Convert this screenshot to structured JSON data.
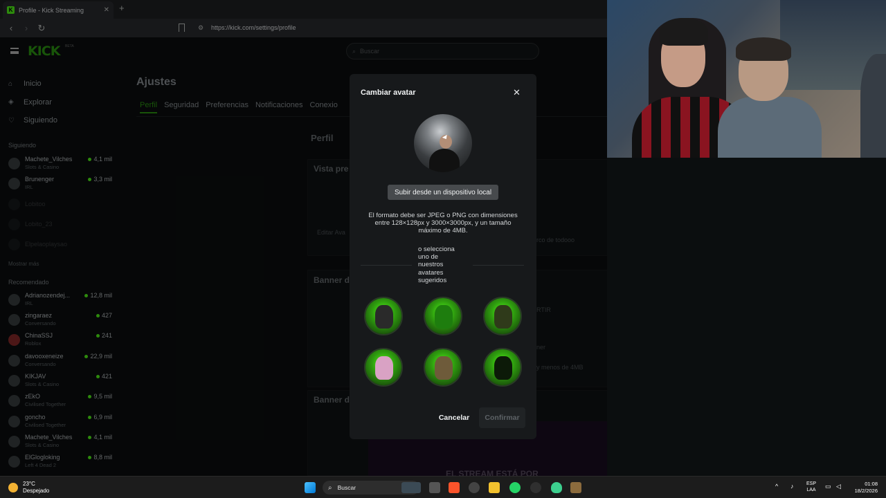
{
  "browser": {
    "tab_title": "Profile - Kick Streaming",
    "tab_close": "✕",
    "new_tab": "+",
    "url": "https://kick.com/settings/profile"
  },
  "kick": {
    "logo": "KICK",
    "beta": "BETA",
    "search_placeholder": "Buscar",
    "nav": [
      {
        "label": "Inicio",
        "icon": "home-icon",
        "glyph": "⌂"
      },
      {
        "label": "Explorar",
        "icon": "compass-icon",
        "glyph": "◈"
      },
      {
        "label": "Siguiendo",
        "icon": "heart-icon",
        "glyph": "♡"
      }
    ],
    "following_header": "Siguiendo",
    "following": [
      {
        "name": "Machete_Vilches",
        "category": "Slots & Casino",
        "viewers": "4,1 mil",
        "live": true
      },
      {
        "name": "Brunenger",
        "category": "IRL",
        "viewers": "3,3 mil",
        "live": true
      },
      {
        "name": "Lobitoo",
        "category": "",
        "viewers": "",
        "live": false
      },
      {
        "name": "Lobito_23",
        "category": "",
        "viewers": "",
        "live": false
      },
      {
        "name": "Elpelaoplaysao",
        "category": "",
        "viewers": "",
        "live": false
      }
    ],
    "show_more": "Mostrar más",
    "recommended_header": "Recomendado",
    "recommended": [
      {
        "name": "Adrianozendej...",
        "category": "IRL",
        "viewers": "12,8 mil"
      },
      {
        "name": "zingaraez",
        "category": "Conversando",
        "viewers": "427"
      },
      {
        "name": "ChinaSSJ",
        "category": "Roblox",
        "viewers": "241"
      },
      {
        "name": "davooxeneize",
        "category": "Conversando",
        "viewers": "22,9 mil"
      },
      {
        "name": "KIKJAV",
        "category": "Slots & Casino",
        "viewers": "421"
      },
      {
        "name": "zEkO",
        "category": "Civilised Together",
        "viewers": "9,5 mil"
      },
      {
        "name": "goncho",
        "category": "Civilised Together",
        "viewers": "6,9 mil"
      },
      {
        "name": "Machete_Vilches",
        "category": "Slots & Casino",
        "viewers": "4,1 mil"
      },
      {
        "name": "ElGlogloking",
        "category": "Left 4 Dead 2",
        "viewers": "8,8 mil"
      }
    ],
    "settings_title": "Ajustes",
    "settings_tabs": [
      "Perfil",
      "Seguridad",
      "Preferencias",
      "Notificaciones",
      "Conexio"
    ],
    "profile_heading": "Perfil",
    "preview_heading": "Vista pre",
    "edit_avatar": "Editar Ava",
    "banner_heading": "Banner d",
    "banner_heading_2": "Banner de",
    "bg_text_1": "rco de todooo",
    "bg_text_2": "y menos de 4MB",
    "bg_text_3": "ner",
    "bg_text_4": "RTIR",
    "bg_stream": "EL STREAM ESTÁ POR"
  },
  "modal": {
    "title": "Cambiar avatar",
    "close": "✕",
    "upload_button": "Subir desde un dispositivo local",
    "format_note": "El formato debe ser JPEG o PNG con dimensiones entre 128×128px y 3000×3000px, y un tamaño máximo de 4MB.",
    "or_text": "o selecciona uno de nuestros avatares sugeridos",
    "cancel": "Cancelar",
    "confirm": "Confirmar"
  },
  "taskbar": {
    "temperature": "23°C",
    "weather": "Despejado",
    "search": "Buscar",
    "lang_1": "ESP",
    "lang_2": "LAA",
    "time": "01:08",
    "date": "18/2/2026"
  },
  "colors": {
    "kick_green": "#53fc18",
    "modal_bg": "#17191b"
  }
}
